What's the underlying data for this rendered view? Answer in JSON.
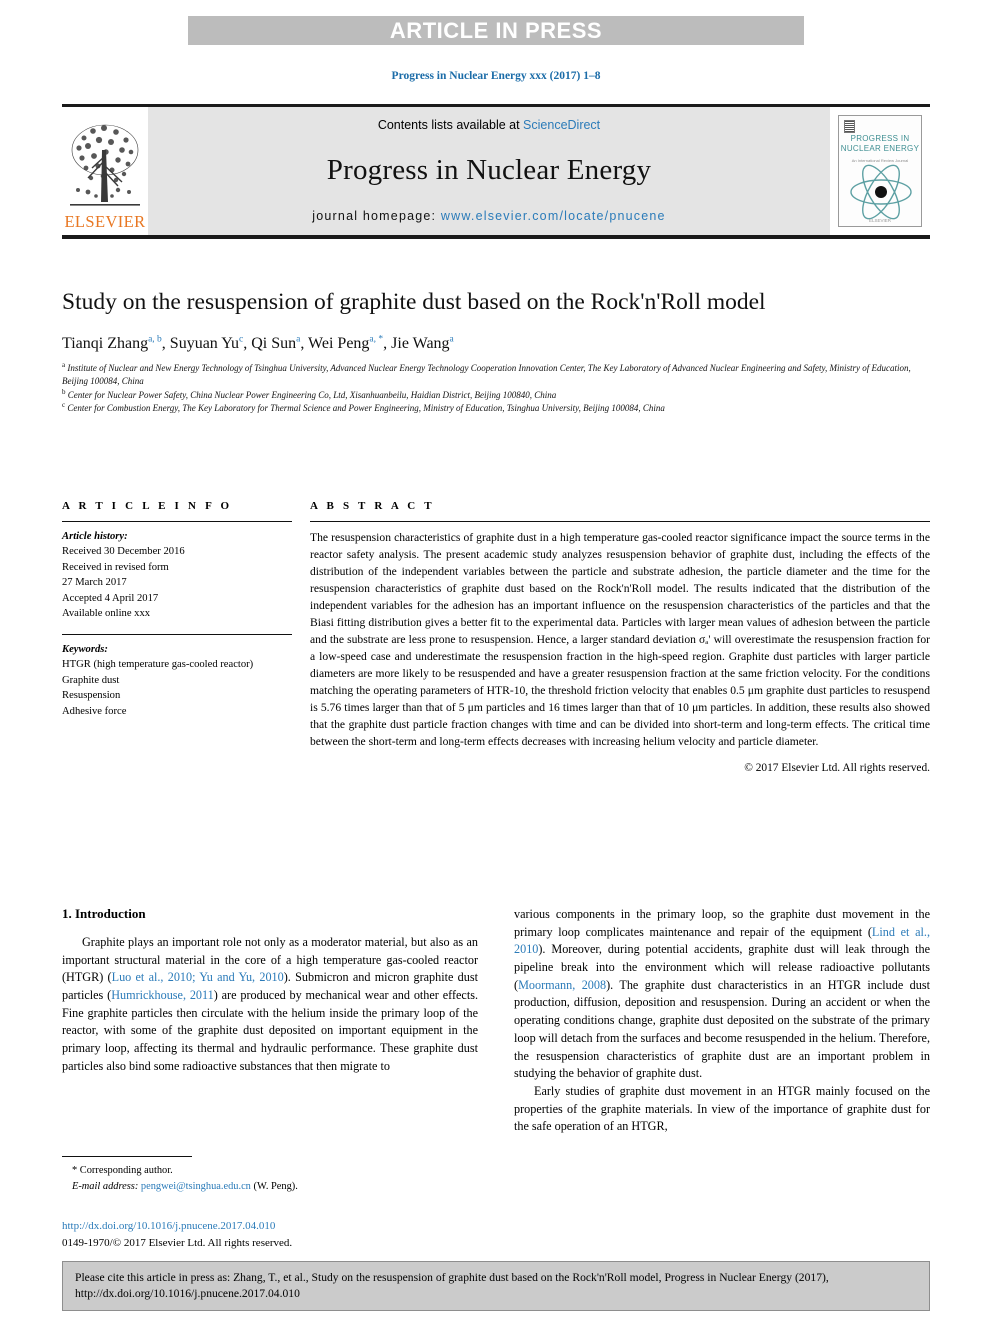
{
  "banner": {
    "text": "ARTICLE IN PRESS"
  },
  "journal_line": "Progress in Nuclear Energy xxx (2017) 1–8",
  "masthead": {
    "contents_prefix": "Contents lists available at ",
    "contents_link": "ScienceDirect",
    "journal_title": "Progress in Nuclear Energy",
    "homepage_prefix": "journal homepage: ",
    "homepage_url": "www.elsevier.com/locate/pnucene",
    "publisher": "ELSEVIER",
    "cover": {
      "title": "PROGRESS IN NUCLEAR ENERGY",
      "subtitle": "An International Review Journal",
      "footer": "ELSEVIER"
    }
  },
  "article": {
    "title": "Study on the resuspension of graphite dust based on the Rock'n'Roll model",
    "authors": [
      {
        "name": "Tianqi Zhang",
        "sup": "a, b",
        "sep": ", "
      },
      {
        "name": "Suyuan Yu",
        "sup": "c",
        "sep": ", "
      },
      {
        "name": "Qi Sun",
        "sup": "a",
        "sep": ", "
      },
      {
        "name": "Wei Peng",
        "sup": "a, *",
        "sep": ", "
      },
      {
        "name": "Jie Wang",
        "sup": "a",
        "sep": ""
      }
    ],
    "affiliations": [
      {
        "mark": "a",
        "text": "Institute of Nuclear and New Energy Technology of Tsinghua University, Advanced Nuclear Energy Technology Cooperation Innovation Center, The Key Laboratory of Advanced Nuclear Engineering and Safety, Ministry of Education, Beijing 100084, China"
      },
      {
        "mark": "b",
        "text": "Center for Nuclear Power Safety, China Nuclear Power Engineering Co, Ltd, Xisanhuanbeilu, Haidian District, Beijing 100840, China"
      },
      {
        "mark": "c",
        "text": "Center for Combustion Energy, The Key Laboratory for Thermal Science and Power Engineering, Ministry of Education, Tsinghua University, Beijing 100084, China"
      }
    ]
  },
  "article_info": {
    "heading": "A R T I C L E   I N F O",
    "history_label": "Article history:",
    "history": [
      "Received 30 December 2016",
      "Received in revised form",
      "27 March 2017",
      "Accepted 4 April 2017",
      "Available online xxx"
    ],
    "keywords_label": "Keywords:",
    "keywords": [
      "HTGR (high temperature gas-cooled reactor)",
      "Graphite dust",
      "Resuspension",
      "Adhesive force"
    ]
  },
  "abstract": {
    "heading": "A B S T R A C T",
    "text": "The resuspension characteristics of graphite dust in a high temperature gas-cooled reactor significance impact the source terms in the reactor safety analysis. The present academic study analyzes resuspension behavior of graphite dust, including the effects of the distribution of the independent variables between the particle and substrate adhesion, the particle diameter and the time for the resuspension characteristics of graphite dust based on the Rock'n'Roll model. The results indicated that the distribution of the independent variables for the adhesion has an important influence on the resuspension characteristics of the particles and that the Biasi fitting distribution gives a better fit to the experimental data. Particles with larger mean values of adhesion between the particle and the substrate are less prone to resuspension. Hence, a larger standard deviation σₐ' will overestimate the resuspension fraction for a low-speed case and underestimate the resuspension fraction in the high-speed region. Graphite dust particles with larger particle diameters are more likely to be resuspended and have a greater resuspension fraction at the same friction velocity. For the conditions matching the operating parameters of HTR-10, the threshold friction velocity that enables 0.5 μm graphite dust particles to resuspend is 5.76 times larger than that of 5 μm particles and 16 times larger than that of 10 μm particles. In addition, these results also showed that the graphite dust particle fraction changes with time and can be divided into short-term and long-term effects. The critical time between the short-term and long-term effects decreases with increasing helium velocity and particle diameter.",
    "copyright": "© 2017 Elsevier Ltd. All rights reserved."
  },
  "body": {
    "section_title": "1. Introduction",
    "left_paragraph_parts": [
      {
        "t": "Graphite plays an important role not only as a moderator material, but also as an important structural material in the core of a high temperature gas-cooled reactor (HTGR) (",
        "cite": false
      },
      {
        "t": "Luo et al., 2010; Yu and Yu, 2010",
        "cite": true
      },
      {
        "t": "). Submicron and micron graphite dust particles (",
        "cite": false
      },
      {
        "t": "Humrickhouse, 2011",
        "cite": true
      },
      {
        "t": ") are produced by mechanical wear and other effects. Fine graphite particles then circulate with the helium inside the primary loop of the reactor, with some of the graphite dust deposited on important equipment in the primary loop, affecting its thermal and hydraulic performance. These graphite dust particles also bind some radioactive substances that then migrate to",
        "cite": false
      }
    ],
    "right_paragraph_parts": [
      {
        "t": "various components in the primary loop, so the graphite dust movement in the primary loop complicates maintenance and repair of the equipment (",
        "cite": false
      },
      {
        "t": "Lind et al., 2010",
        "cite": true
      },
      {
        "t": "). Moreover, during potential accidents, graphite dust will leak through the pipeline break into the environment which will release radioactive pollutants (",
        "cite": false
      },
      {
        "t": "Moormann, 2008",
        "cite": true
      },
      {
        "t": "). The graphite dust characteristics in an HTGR include dust production, diffusion, deposition and resuspension. During an accident or when the operating conditions change, graphite dust deposited on the substrate of the primary loop will detach from the surfaces and become resuspended in the helium. Therefore, the resuspension characteristics of graphite dust are an important problem in studying the behavior of graphite dust.",
        "cite": false
      }
    ],
    "right_paragraph2": "Early studies of graphite dust movement in an HTGR mainly focused on the properties of the graphite materials. In view of the importance of graphite dust for the safe operation of an HTGR,"
  },
  "footnote": {
    "corresponding": "* Corresponding author.",
    "email_label": "E-mail address:",
    "email": "pengwei@tsinghua.edu.cn",
    "email_suffix": "(W. Peng).",
    "doi": "http://dx.doi.org/10.1016/j.pnucene.2017.04.010",
    "issn_line": "0149-1970/© 2017 Elsevier Ltd. All rights reserved."
  },
  "cite_box": {
    "text": "Please cite this article in press as: Zhang, T., et al., Study on the resuspension of graphite dust based on the Rock'n'Roll model, Progress in Nuclear Energy (2017), http://dx.doi.org/10.1016/j.pnucene.2017.04.010"
  },
  "colors": {
    "link": "#2b7bb9",
    "banner_bg": "#bcbcbc",
    "masthead_bg": "#e4e4e4",
    "elsevier_orange": "#e87722",
    "cover_teal": "#3f8f92",
    "cite_box_bg": "#cbcbcb"
  }
}
